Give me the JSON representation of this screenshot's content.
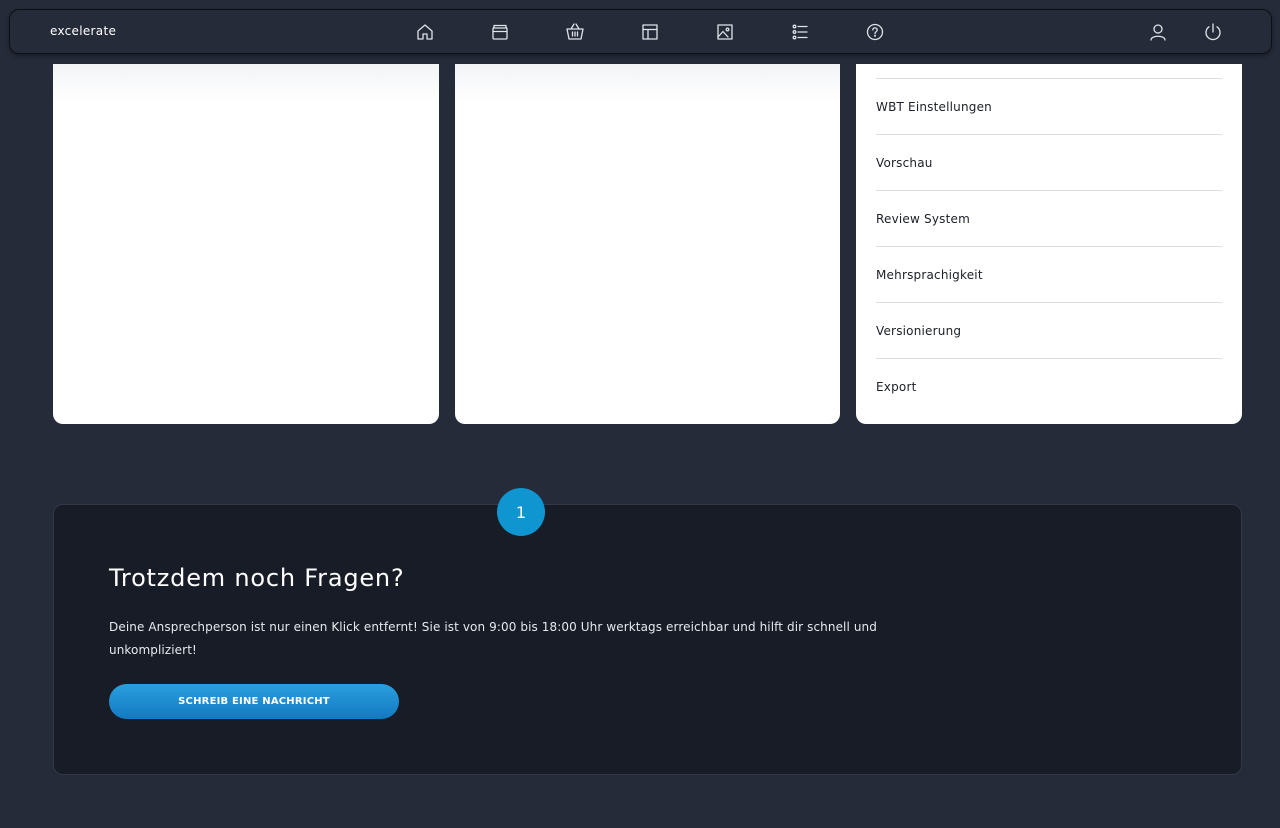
{
  "navbar": {
    "brand": "excelerate",
    "icons": [
      "home-icon",
      "box-icon",
      "basket-icon",
      "layout-icon",
      "image-icon",
      "list-icon",
      "help-icon",
      "user-icon",
      "power-icon"
    ]
  },
  "feature_list": {
    "items": [
      "WBT Einstellungen",
      "Vorschau",
      "Review System",
      "Mehrsprachigkeit",
      "Versionierung",
      "Export"
    ]
  },
  "contact": {
    "step": "1",
    "title": "Trotzdem noch Fragen?",
    "text": "Deine Ansprechperson ist nur einen Klick entfernt! Sie ist von 9:00 bis 18:00 Uhr werktags erreichbar und hilft dir schnell und unkompliziert!",
    "button_label": "SCHREIB EINE NACHRICHT"
  },
  "colors": {
    "background": "#252b38",
    "panel": "#171c26",
    "accent": "#0f95cf",
    "card": "#ffffff"
  }
}
